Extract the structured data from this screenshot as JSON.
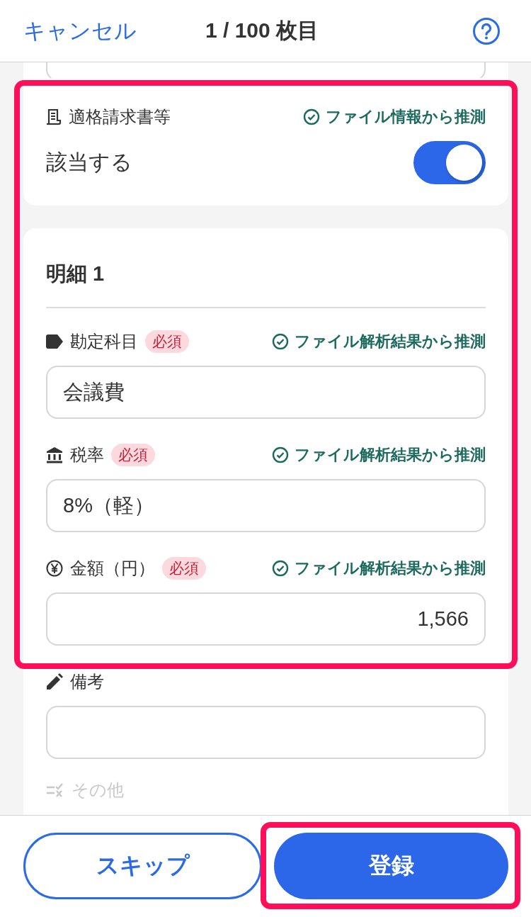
{
  "header": {
    "cancel": "キャンセル",
    "title": "1 / 100 枚目"
  },
  "invoice_card": {
    "label": "適格請求書等",
    "hint": "ファイル情報から推測",
    "toggle_label": "該当する",
    "on": true
  },
  "detail": {
    "title": "明細 1",
    "fields": [
      {
        "kind": "account",
        "label": "勘定科目",
        "badge": "必須",
        "hint": "ファイル解析結果から推測",
        "value": "会議費"
      },
      {
        "kind": "tax",
        "label": "税率",
        "badge": "必須",
        "hint": "ファイル解析結果から推測",
        "value": "8%（軽）"
      },
      {
        "kind": "amount",
        "label": "金額（円）",
        "badge": "必須",
        "hint": "ファイル解析結果から推測",
        "value": "1,566"
      },
      {
        "kind": "note",
        "label": "備考"
      }
    ],
    "other": {
      "label": "その他",
      "disabled": true
    }
  },
  "footer": {
    "skip": "スキップ",
    "submit": "登録"
  }
}
